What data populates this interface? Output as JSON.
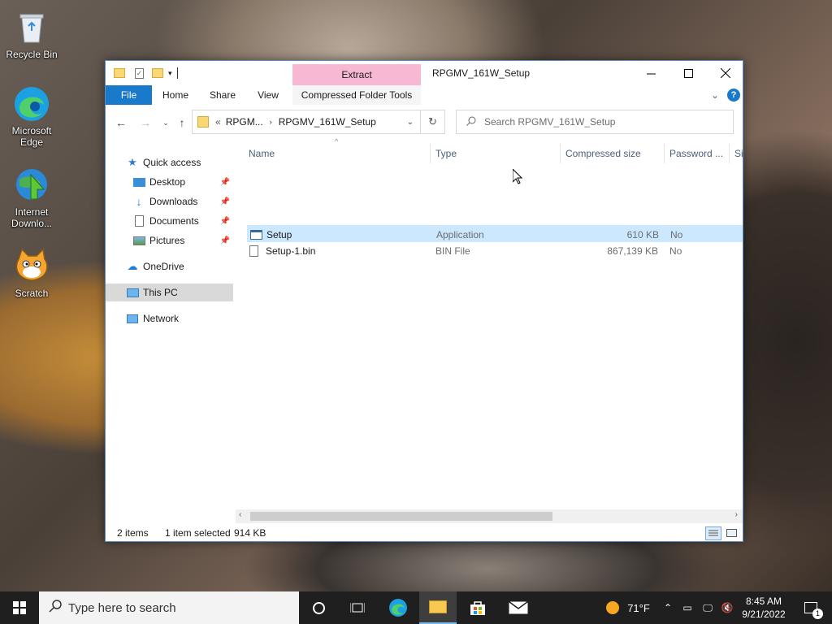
{
  "desktop": {
    "icons": [
      {
        "label": "Recycle Bin"
      },
      {
        "label": "Microsoft Edge"
      },
      {
        "label": "Internet Downlo..."
      },
      {
        "label": "Scratch"
      }
    ]
  },
  "window": {
    "title": "RPGMV_161W_Setup",
    "context_group": "Extract",
    "tabs": {
      "file": "File",
      "home": "Home",
      "share": "Share",
      "view": "View",
      "compressed": "Compressed Folder Tools"
    },
    "address": {
      "chevron": "«",
      "crumb1": "RPGM...",
      "crumb2": "RPGMV_161W_Setup"
    },
    "search": {
      "placeholder": "Search RPGMV_161W_Setup"
    },
    "nav": {
      "quick_access": "Quick access",
      "desktop": "Desktop",
      "downloads": "Downloads",
      "documents": "Documents",
      "pictures": "Pictures",
      "onedrive": "OneDrive",
      "this_pc": "This PC",
      "network": "Network"
    },
    "columns": {
      "name": "Name",
      "type": "Type",
      "compressed_size": "Compressed size",
      "password": "Password ...",
      "size": "Si"
    },
    "files": [
      {
        "name": "Setup",
        "type": "Application",
        "compressed_size": "610 KB",
        "password": "No"
      },
      {
        "name": "Setup-1.bin",
        "type": "BIN File",
        "compressed_size": "867,139 KB",
        "password": "No"
      }
    ],
    "status": {
      "items": "2 items",
      "selected": "1 item selected",
      "size": "914 KB"
    }
  },
  "taskbar": {
    "search_placeholder": "Type here to search",
    "weather": "71°F",
    "time": "8:45 AM",
    "date": "9/21/2022",
    "notification_count": "1"
  },
  "colors": {
    "accent": "#1979ca",
    "context_tab": "#f7b8d4",
    "selection": "#cce8ff",
    "taskbar": "#1f1f1f"
  }
}
